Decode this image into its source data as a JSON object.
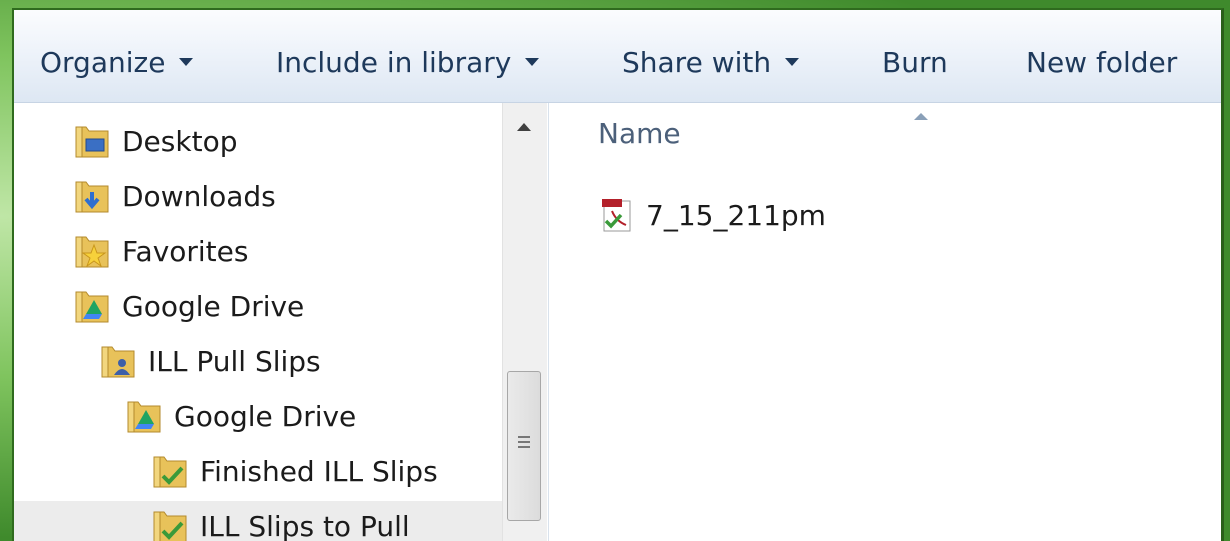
{
  "toolbar": {
    "items": [
      {
        "label": "Organize",
        "has_dropdown": true
      },
      {
        "label": "Include in library",
        "has_dropdown": true
      },
      {
        "label": "Share with",
        "has_dropdown": true
      },
      {
        "label": "Burn",
        "has_dropdown": false
      },
      {
        "label": "New folder",
        "has_dropdown": false
      }
    ]
  },
  "nav": {
    "items": [
      {
        "label": "Desktop",
        "icon": "desktop-folder-icon",
        "selected": false
      },
      {
        "label": "Downloads",
        "icon": "downloads-folder-icon",
        "selected": false
      },
      {
        "label": "Favorites",
        "icon": "favorites-folder-icon",
        "selected": false
      },
      {
        "label": "Google Drive",
        "icon": "google-drive-folder-icon",
        "selected": false
      },
      {
        "label": "ILL Pull Slips",
        "icon": "shared-folder-icon",
        "selected": false
      },
      {
        "label": "Google Drive",
        "icon": "google-drive-folder-icon",
        "selected": false
      },
      {
        "label": "Finished ILL Slips",
        "icon": "synced-folder-icon",
        "selected": false
      },
      {
        "label": "ILL Slips to Pull",
        "icon": "synced-folder-icon",
        "selected": true
      }
    ]
  },
  "content": {
    "column_header": "Name",
    "files": [
      {
        "name": "7_15_211pm",
        "icon": "pdf-synced-file-icon"
      }
    ]
  },
  "colors": {
    "toolbar_text": "#1e395b",
    "selected_row": "#ececec",
    "window_border": "#2f6b1e"
  }
}
